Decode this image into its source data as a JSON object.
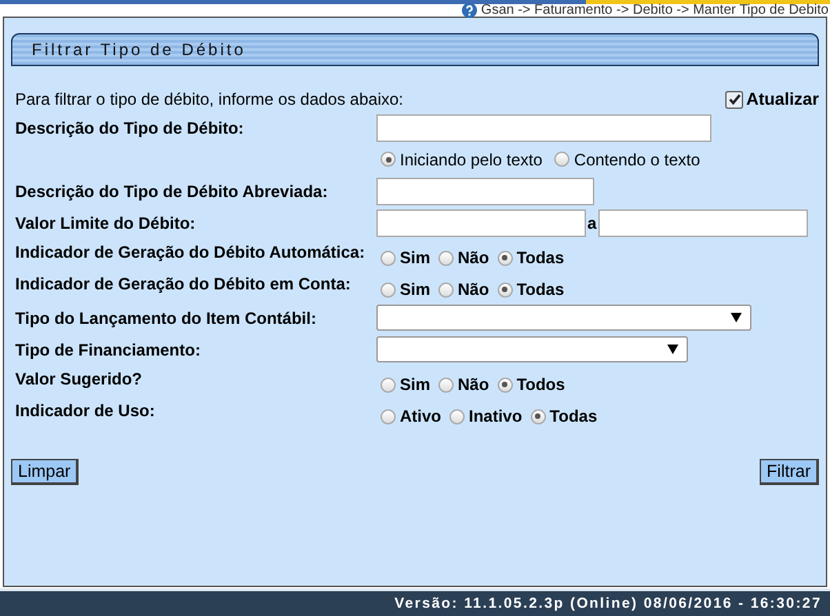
{
  "breadcrumb": "Gsan -> Faturamento -> Debito -> Manter Tipo de Debito",
  "panel_title": "Filtrar Tipo de Débito",
  "intro": "Para filtrar o tipo de débito, informe os dados abaixo:",
  "update": {
    "label": "Atualizar",
    "checked": true
  },
  "rows": [
    {
      "kind": "text",
      "label": "Descrição do Tipo de Débito:"
    },
    {
      "kind": "radio",
      "options": [
        {
          "label": "Iniciando pelo texto",
          "selected": true
        },
        {
          "label": "Contendo o texto",
          "selected": false
        }
      ]
    },
    {
      "kind": "text",
      "label": "Descrição do Tipo de Débito Abreviada:"
    },
    {
      "kind": "range",
      "label": "Valor Limite do Débito:",
      "separator": "a"
    },
    {
      "kind": "radio",
      "label": "Indicador de Geração do Débito Automática:",
      "options": [
        {
          "label": "Sim",
          "selected": false
        },
        {
          "label": "Não",
          "selected": false
        },
        {
          "label": "Todas",
          "selected": true
        }
      ]
    },
    {
      "kind": "radio",
      "label": "Indicador de Geração do Débito em Conta:",
      "options": [
        {
          "label": "Sim",
          "selected": false
        },
        {
          "label": "Não",
          "selected": false
        },
        {
          "label": "Todas",
          "selected": true
        }
      ]
    },
    {
      "kind": "select",
      "label": "Tipo do Lançamento do Item Contábil:"
    },
    {
      "kind": "select",
      "label": "Tipo de Financiamento:"
    },
    {
      "kind": "radio",
      "label": "Valor Sugerido?",
      "options": [
        {
          "label": "Sim",
          "selected": false
        },
        {
          "label": "Não",
          "selected": false
        },
        {
          "label": "Todos",
          "selected": true
        }
      ]
    },
    {
      "kind": "radio",
      "label": "Indicador de Uso:",
      "options": [
        {
          "label": "Ativo",
          "selected": false
        },
        {
          "label": "Inativo",
          "selected": false
        },
        {
          "label": "Todas",
          "selected": true
        }
      ]
    }
  ],
  "buttons": {
    "clear": "Limpar",
    "filter": "Filtrar"
  },
  "footer": "Versão: 11.1.05.2.3p (Online) 08/06/2016 - 16:30:27"
}
